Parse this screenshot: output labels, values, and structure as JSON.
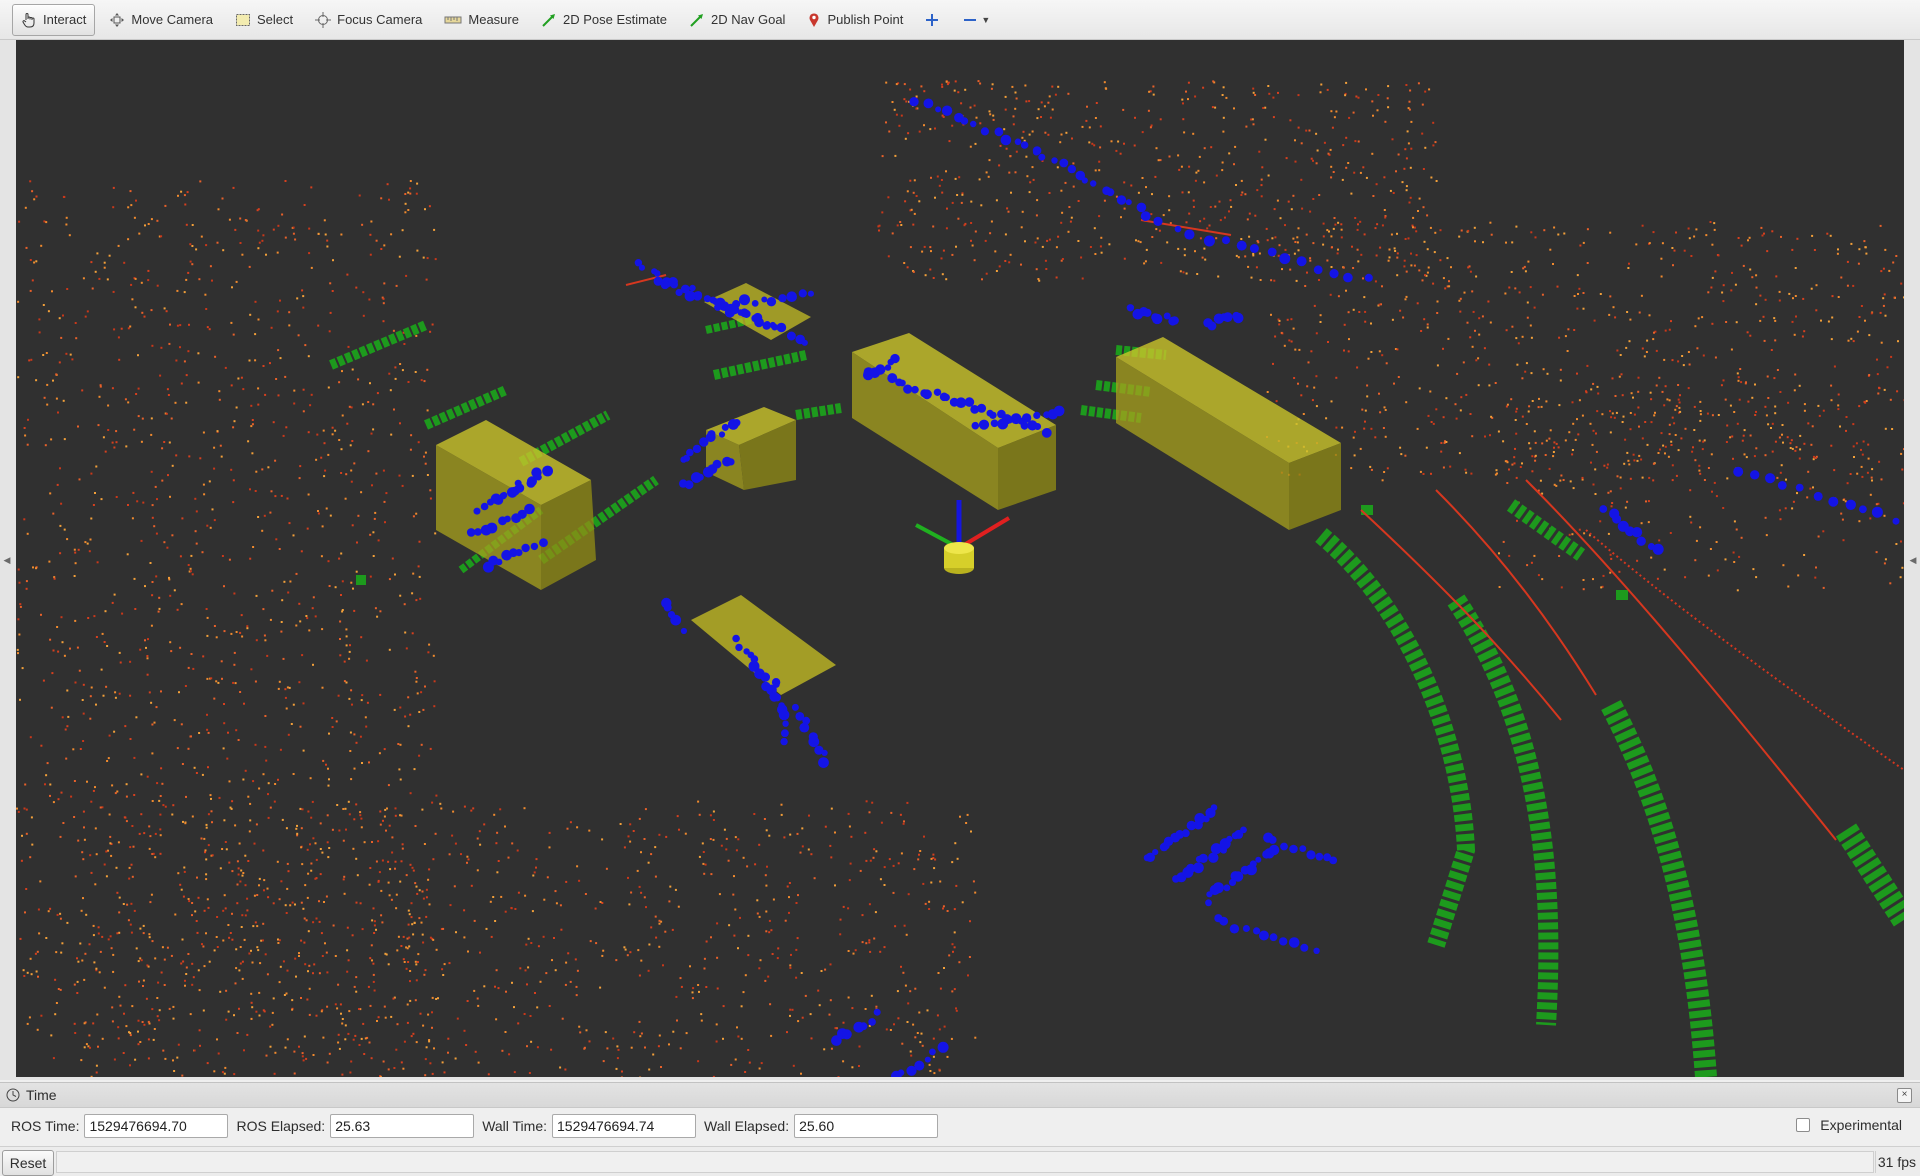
{
  "toolbar": {
    "tools": [
      {
        "label": "Interact",
        "icon": "hand-cursor-icon",
        "active": true
      },
      {
        "label": "Move Camera",
        "icon": "move-camera-icon"
      },
      {
        "label": "Select",
        "icon": "select-box-icon"
      },
      {
        "label": "Focus Camera",
        "icon": "focus-crosshair-icon"
      },
      {
        "label": "Measure",
        "icon": "ruler-icon"
      },
      {
        "label": "2D Pose Estimate",
        "icon": "green-arrow-icon"
      },
      {
        "label": "2D Nav Goal",
        "icon": "green-arrow-icon"
      },
      {
        "label": "Publish Point",
        "icon": "map-pin-icon"
      }
    ],
    "add_tool_icon": "plus-icon",
    "remove_tool_icon": "minus-icon"
  },
  "time_panel": {
    "title": "Time",
    "ros_time_label": "ROS Time:",
    "ros_time_value": "1529476694.70",
    "ros_elapsed_label": "ROS Elapsed:",
    "ros_elapsed_value": "25.63",
    "wall_time_label": "Wall Time:",
    "wall_time_value": "1529476694.74",
    "wall_elapsed_label": "Wall Elapsed:",
    "wall_elapsed_value": "25.60",
    "experimental_label": "Experimental",
    "experimental_checked": false
  },
  "statusbar": {
    "reset_label": "Reset",
    "fps": "31 fps"
  },
  "colors": {
    "background": "#303030",
    "point_cloud": "#e8612a",
    "cluster_points": "#1010e0",
    "ground_markers": "#1d9a1d",
    "bounding_boxes": "#c8c020"
  }
}
